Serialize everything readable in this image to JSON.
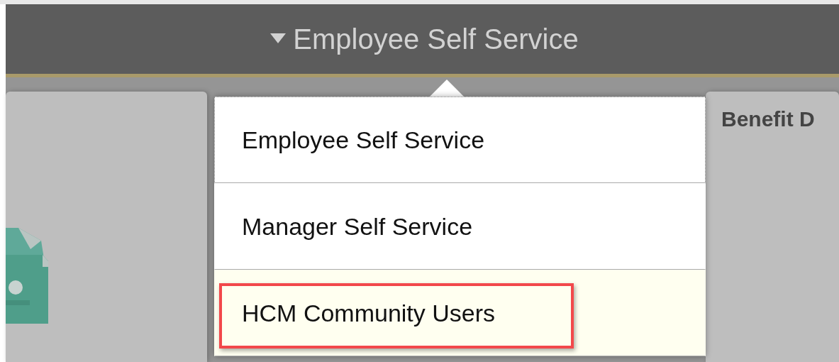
{
  "header": {
    "title": "Employee Self Service",
    "expanded": true
  },
  "tiles": [
    {
      "kind": "icon"
    },
    {
      "kind": "text",
      "title": "Benefit D"
    }
  ],
  "menu": {
    "items": [
      {
        "label": "Employee Self Service",
        "focused": true,
        "hovered": false,
        "annotated": false
      },
      {
        "label": "Manager Self Service",
        "focused": false,
        "hovered": false,
        "annotated": false
      },
      {
        "label": "HCM Community Users",
        "focused": false,
        "hovered": true,
        "annotated": true
      }
    ]
  }
}
